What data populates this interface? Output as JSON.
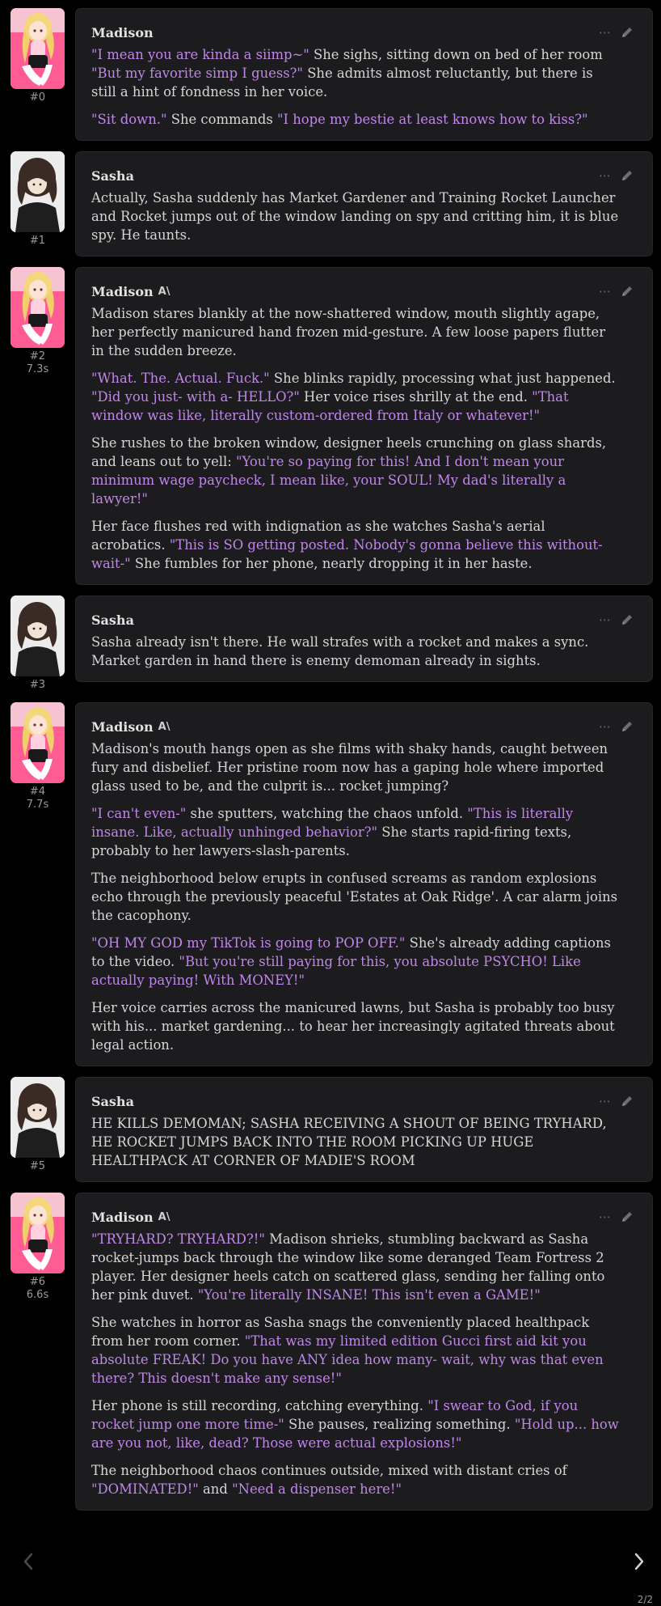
{
  "colors": {
    "background": "#000000",
    "bubble": "#1c1c1e",
    "quote": "#bf87e8",
    "text": "#d6d6d6",
    "muted": "#9a9a9a"
  },
  "icons": {
    "more": "⋯",
    "edit": "pencil-icon",
    "ai_badge": "A\\"
  },
  "messages": [
    {
      "id": "#0",
      "time": "",
      "name": "Madison",
      "ai": false,
      "avatar": "madison",
      "paragraphs": [
        [
          {
            "q": true,
            "t": "\"I mean you are kinda a siimp~\""
          },
          {
            "q": false,
            "t": " She sighs, sitting down on bed of her room "
          },
          {
            "q": true,
            "t": "\"But my favorite simp I guess?\""
          },
          {
            "q": false,
            "t": " She admits almost reluctantly, but there is still a hint of fondness in her voice."
          }
        ],
        [
          {
            "q": true,
            "t": "\"Sit down.\""
          },
          {
            "q": false,
            "t": " She commands "
          },
          {
            "q": true,
            "t": "\"I hope my bestie at least knows how to kiss?\""
          }
        ]
      ]
    },
    {
      "id": "#1",
      "time": "",
      "name": "Sasha",
      "ai": false,
      "avatar": "sasha",
      "paragraphs": [
        [
          {
            "q": false,
            "t": "Actually, Sasha suddenly has Market Gardener and Training Rocket Launcher and Rocket jumps out of the window landing on spy and critting him, it is blue spy. He taunts."
          }
        ]
      ]
    },
    {
      "id": "#2",
      "time": "7.3s",
      "name": "Madison",
      "ai": true,
      "avatar": "madison",
      "paragraphs": [
        [
          {
            "q": false,
            "t": "Madison stares blankly at the now-shattered window, mouth slightly agape, her perfectly manicured hand frozen mid-gesture. A few loose papers flutter in the sudden breeze."
          }
        ],
        [
          {
            "q": true,
            "t": "\"What. The. Actual. Fuck.\""
          },
          {
            "q": false,
            "t": " She blinks rapidly, processing what just happened. "
          },
          {
            "q": true,
            "t": "\"Did you just- with a- HELLO?\""
          },
          {
            "q": false,
            "t": " Her voice rises shrilly at the end. "
          },
          {
            "q": true,
            "t": "\"That window was like, literally custom-ordered from Italy or whatever!\""
          }
        ],
        [
          {
            "q": false,
            "t": "She rushes to the broken window, designer heels crunching on glass shards, and leans out to yell: "
          },
          {
            "q": true,
            "t": "\"You're so paying for this! And I don't mean your minimum wage paycheck, I mean like, your SOUL! My dad's literally a lawyer!\""
          }
        ],
        [
          {
            "q": false,
            "t": "Her face flushes red with indignation as she watches Sasha's aerial acrobatics. "
          },
          {
            "q": true,
            "t": "\"This is SO getting posted. Nobody's gonna believe this without- wait-\""
          },
          {
            "q": false,
            "t": " She fumbles for her phone, nearly dropping it in her haste."
          }
        ]
      ]
    },
    {
      "id": "#3",
      "time": "",
      "name": "Sasha",
      "ai": false,
      "avatar": "sasha",
      "paragraphs": [
        [
          {
            "q": false,
            "t": "Sasha already isn't there. He wall strafes with a rocket and makes a sync. Market garden in hand there is enemy demoman already in sights."
          }
        ]
      ]
    },
    {
      "id": "#4",
      "time": "7.7s",
      "name": "Madison",
      "ai": true,
      "avatar": "madison",
      "paragraphs": [
        [
          {
            "q": false,
            "t": "Madison's mouth hangs open as she films with shaky hands, caught between fury and disbelief. Her pristine room now has a gaping hole where imported glass used to be, and the culprit is... rocket jumping?"
          }
        ],
        [
          {
            "q": true,
            "t": "\"I can't even-\""
          },
          {
            "q": false,
            "t": " she sputters, watching the chaos unfold. "
          },
          {
            "q": true,
            "t": "\"This is literally insane. Like, actually unhinged behavior?\""
          },
          {
            "q": false,
            "t": " She starts rapid-firing texts, probably to her lawyers-slash-parents."
          }
        ],
        [
          {
            "q": false,
            "t": "The neighborhood below erupts in confused screams as random explosions echo through the previously peaceful 'Estates at Oak Ridge'. A car alarm joins the cacophony."
          }
        ],
        [
          {
            "q": true,
            "t": "\"OH MY GOD my TikTok is going to POP OFF.\""
          },
          {
            "q": false,
            "t": " She's already adding captions to the video. "
          },
          {
            "q": true,
            "t": "\"But you're still paying for this, you absolute PSYCHO! Like actually paying! With MONEY!\""
          }
        ],
        [
          {
            "q": false,
            "t": "Her voice carries across the manicured lawns, but Sasha is probably too busy with his... market gardening... to hear her increasingly agitated threats about legal action."
          }
        ]
      ]
    },
    {
      "id": "#5",
      "time": "",
      "name": "Sasha",
      "ai": false,
      "avatar": "sasha",
      "paragraphs": [
        [
          {
            "q": false,
            "t": "HE KILLS DEMOMAN; SASHA RECEIVING A SHOUT OF BEING TRYHARD, HE ROCKET JUMPS BACK INTO THE ROOM PICKING UP HUGE HEALTHPACK AT CORNER OF MADIE'S ROOM"
          }
        ]
      ]
    },
    {
      "id": "#6",
      "time": "6.6s",
      "name": "Madison",
      "ai": true,
      "avatar": "madison",
      "paragraphs": [
        [
          {
            "q": true,
            "t": "\"TRYHARD? TRYHARD?!\""
          },
          {
            "q": false,
            "t": " Madison shrieks, stumbling backward as Sasha rocket-jumps back through the window like some deranged Team Fortress 2 player. Her designer heels catch on scattered glass, sending her falling onto her pink duvet. "
          },
          {
            "q": true,
            "t": "\"You're literally INSANE! This isn't even a GAME!\""
          }
        ],
        [
          {
            "q": false,
            "t": "She watches in horror as Sasha snags the conveniently placed healthpack from her room corner. "
          },
          {
            "q": true,
            "t": "\"That was my limited edition Gucci first aid kit you absolute FREAK! Do you have ANY idea how many- wait, why was that even there? This doesn't make any sense!\""
          }
        ],
        [
          {
            "q": false,
            "t": "Her phone is still recording, catching everything. "
          },
          {
            "q": true,
            "t": "\"I swear to God, if you rocket jump one more time-\""
          },
          {
            "q": false,
            "t": " She pauses, realizing something. "
          },
          {
            "q": true,
            "t": "\"Hold up... how are you not, like, dead? Those were actual explosions!\""
          }
        ],
        [
          {
            "q": false,
            "t": "The neighborhood chaos continues outside, mixed with distant cries of "
          },
          {
            "q": true,
            "t": "\"DOMINATED!\""
          },
          {
            "q": false,
            "t": " and "
          },
          {
            "q": true,
            "t": "\"Need a dispenser here!\""
          }
        ]
      ]
    }
  ],
  "swipe": {
    "counter": "2/2",
    "left_icon": "chevron-left-icon",
    "right_icon": "chevron-right-icon"
  }
}
